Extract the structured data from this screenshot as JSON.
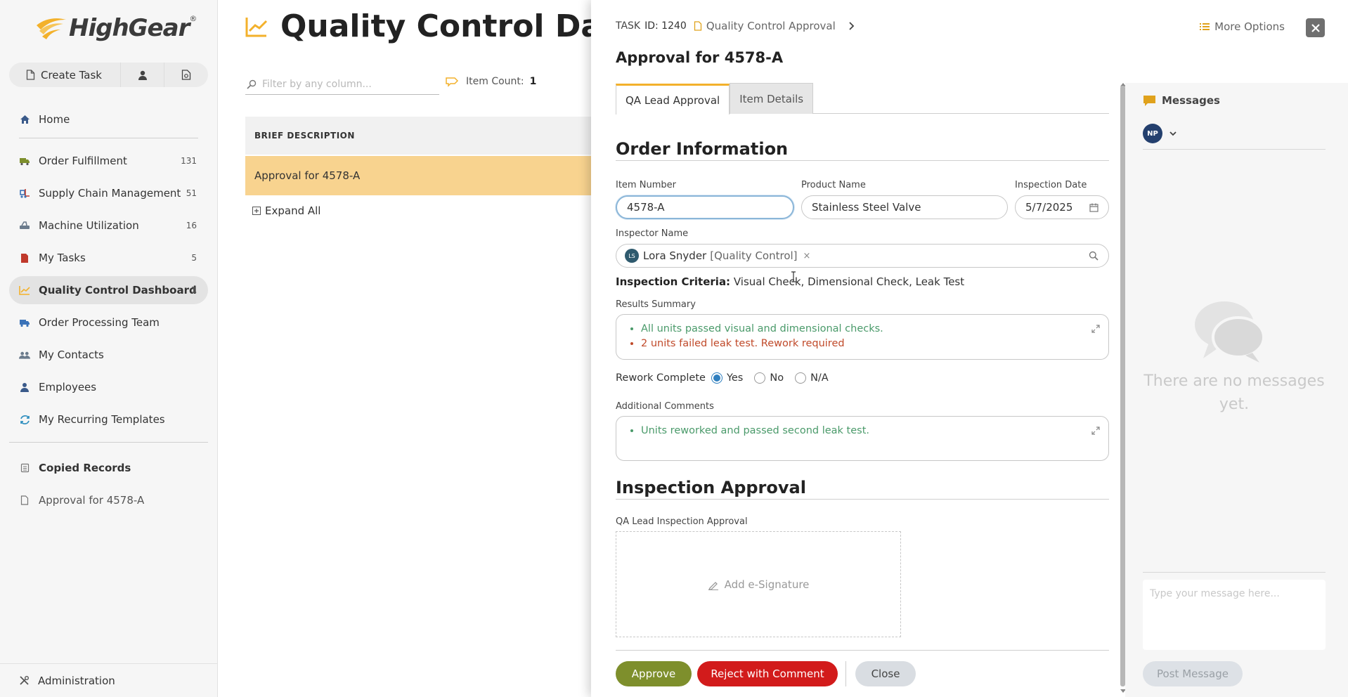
{
  "app": {
    "logo_text": "HighGear",
    "logo_mark": "®"
  },
  "sidebar": {
    "create_task": "Create Task",
    "nav": [
      {
        "label": "Home",
        "count": ""
      },
      {
        "label": "Order Fulfillment",
        "count": "131"
      },
      {
        "label": "Supply Chain Management",
        "count": "51"
      },
      {
        "label": "Machine Utilization",
        "count": "16"
      },
      {
        "label": "My Tasks",
        "count": "5"
      },
      {
        "label": "Quality Control Dashboard",
        "count": "1"
      },
      {
        "label": "Order Processing Team",
        "count": ""
      },
      {
        "label": "My Contacts",
        "count": ""
      },
      {
        "label": "Employees",
        "count": ""
      },
      {
        "label": "My Recurring Templates",
        "count": ""
      }
    ],
    "copied_records_title": "Copied Records",
    "copied_records": [
      {
        "label": "Approval for 4578-A"
      }
    ],
    "administration": "Administration"
  },
  "main": {
    "title": "Quality Control Dashboard",
    "filter_placeholder": "Filter by any column...",
    "item_count_label": "Item Count:",
    "item_count_value": "1",
    "column_header": "BRIEF DESCRIPTION",
    "rows": [
      {
        "description": "Approval for 4578-A"
      }
    ],
    "expand_all": "Expand All"
  },
  "panel": {
    "task_id_label": "TASK",
    "task_id": "ID: 1240",
    "breadcrumb": "Quality Control Approval",
    "more_options": "More Options",
    "title": "Approval for 4578-A",
    "tabs": [
      {
        "label": "QA Lead Approval",
        "active": true
      },
      {
        "label": "Item Details",
        "active": false
      }
    ],
    "order_info_title": "Order Information",
    "item_number_label": "Item Number",
    "item_number": "4578-A",
    "product_name_label": "Product Name",
    "product_name": "Stainless Steel Valve",
    "inspection_date_label": "Inspection Date",
    "inspection_date": "5/7/2025",
    "inspector_label": "Inspector Name",
    "inspector_initials": "LS",
    "inspector_name": "Lora Snyder",
    "inspector_role": "[Quality Control]",
    "inspector_remove": "×",
    "criteria_label": "Inspection Criteria:",
    "criteria_value": "Visual Check, Dimensional Check, Leak Test",
    "results_label": "Results Summary",
    "results": [
      {
        "text": "All units passed visual and dimensional checks.",
        "status": "ok"
      },
      {
        "text": "2 units failed leak test. Rework required",
        "status": "bad"
      }
    ],
    "rework_label": "Rework Complete",
    "rework_options": [
      {
        "label": "Yes",
        "selected": true
      },
      {
        "label": "No",
        "selected": false
      },
      {
        "label": "N/A",
        "selected": false
      }
    ],
    "comments_label": "Additional Comments",
    "comments": [
      {
        "text": "Units reworked and passed second leak test."
      }
    ],
    "approval_title": "Inspection Approval",
    "signature_label": "QA Lead Inspection Approval",
    "signature_action": "Add e-Signature",
    "buttons": {
      "approve": "Approve",
      "reject": "Reject with Comment",
      "close": "Close"
    }
  },
  "messages": {
    "title": "Messages",
    "user_initials": "NP",
    "empty_text": "There are no messages yet.",
    "input_placeholder": "Type your message here...",
    "post": "Post Message"
  },
  "colors": {
    "accent": "#f3b12b",
    "row_highlight": "#f8d38f",
    "approve": "#7e8f2c",
    "reject": "#d21b1b",
    "ok_text": "#4a9a6a",
    "bad_text": "#c04a2a"
  }
}
